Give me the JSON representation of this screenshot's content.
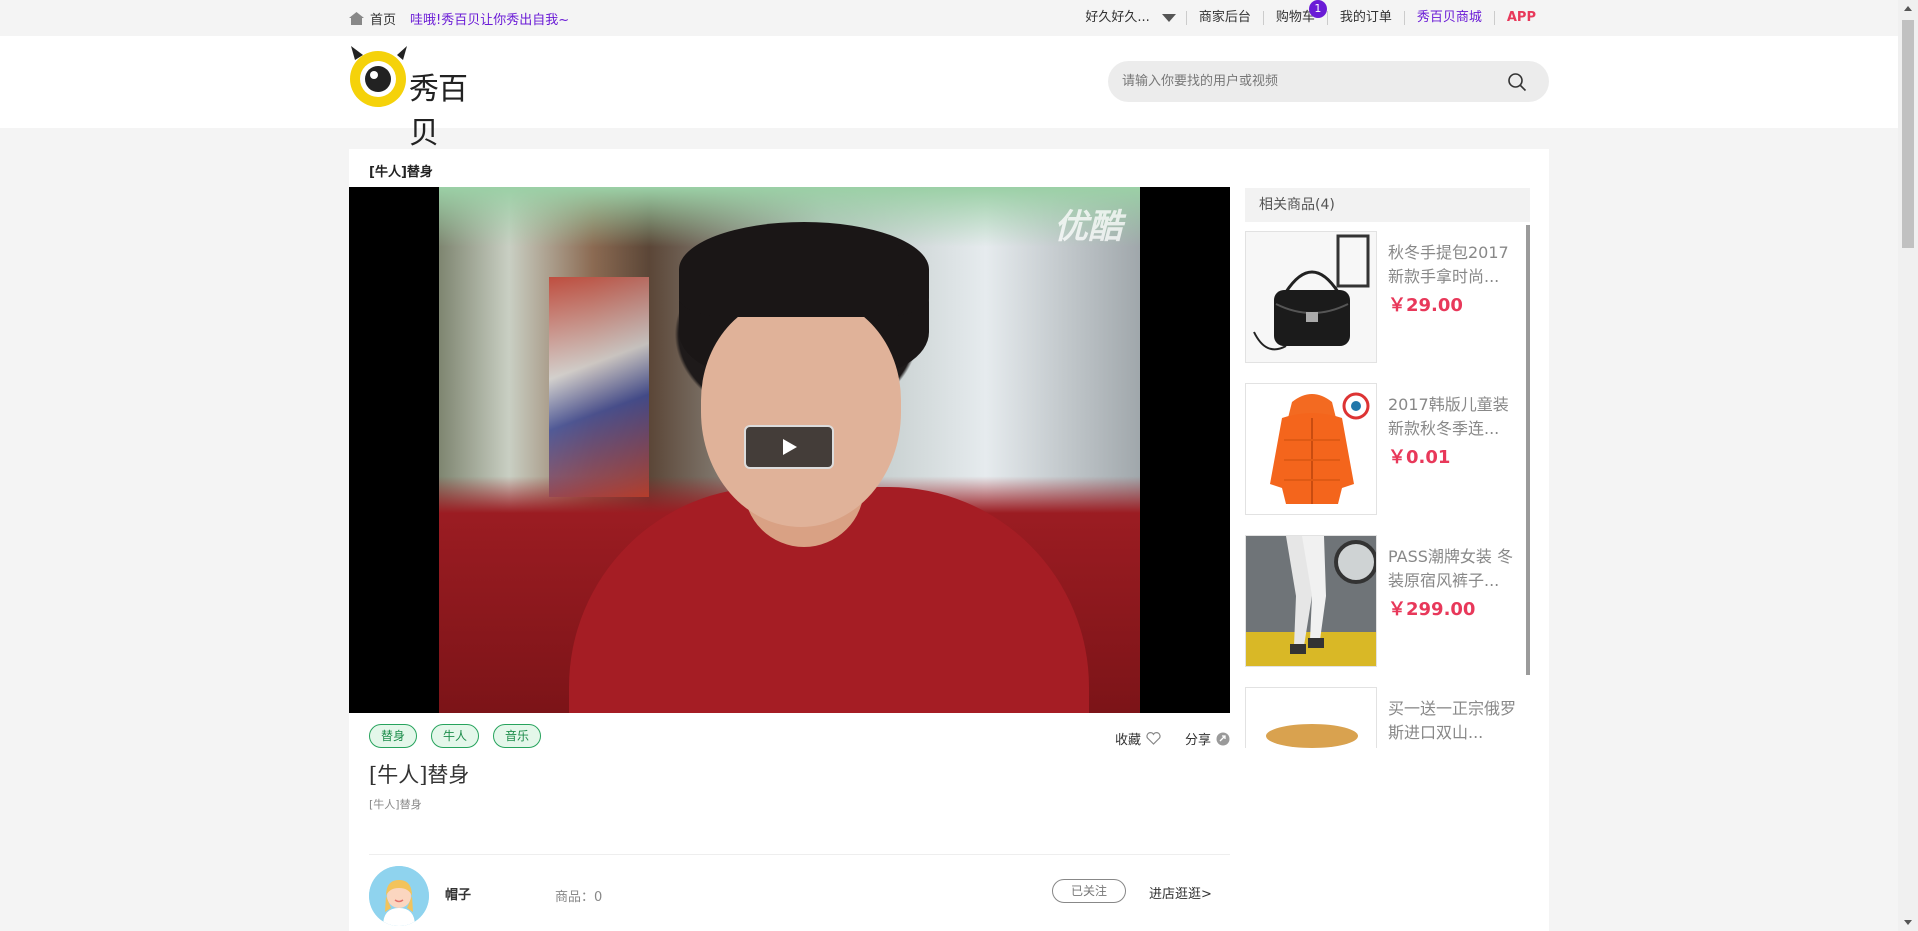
{
  "topbar": {
    "home_label": "首页",
    "slogan": "哇哦!秀百贝让你秀出自我~",
    "user_label": "好久好久...",
    "seller_label": "商家后台",
    "cart_label": "购物车",
    "cart_count": "1",
    "orders_label": "我的订单",
    "mall_label": "秀百贝商城",
    "app_label": "APP"
  },
  "header": {
    "logo_text": "秀百贝",
    "search_placeholder": "请输入你要找的用户或视频"
  },
  "video": {
    "breadcrumb_title": "[牛人]替身",
    "watermark": "优酷",
    "title": "[牛人]替身",
    "description": "[牛人]替身",
    "tags": [
      "替身",
      "牛人",
      "音乐"
    ],
    "favorite_label": "收藏",
    "share_label": "分享"
  },
  "author": {
    "name": "帽子",
    "goods_label": "商品：0",
    "follow_label": "已关注",
    "shop_link": "进店逛逛>"
  },
  "related": {
    "header": "相关商品(4)",
    "products": [
      {
        "name": "秋冬手提包2017新款手拿时尚...",
        "price": "￥29.00"
      },
      {
        "name": "2017韩版儿童装新款秋冬季连...",
        "price": "￥0.01"
      },
      {
        "name": "PASS潮牌女装 冬装原宿风裤子...",
        "price": "￥299.00"
      },
      {
        "name": "买一送一正宗俄罗斯进口双山...",
        "price": ""
      }
    ]
  },
  "colors": {
    "accent_purple": "#6a1bd6",
    "price_red": "#e8385a",
    "tag_green": "#27a35d"
  }
}
